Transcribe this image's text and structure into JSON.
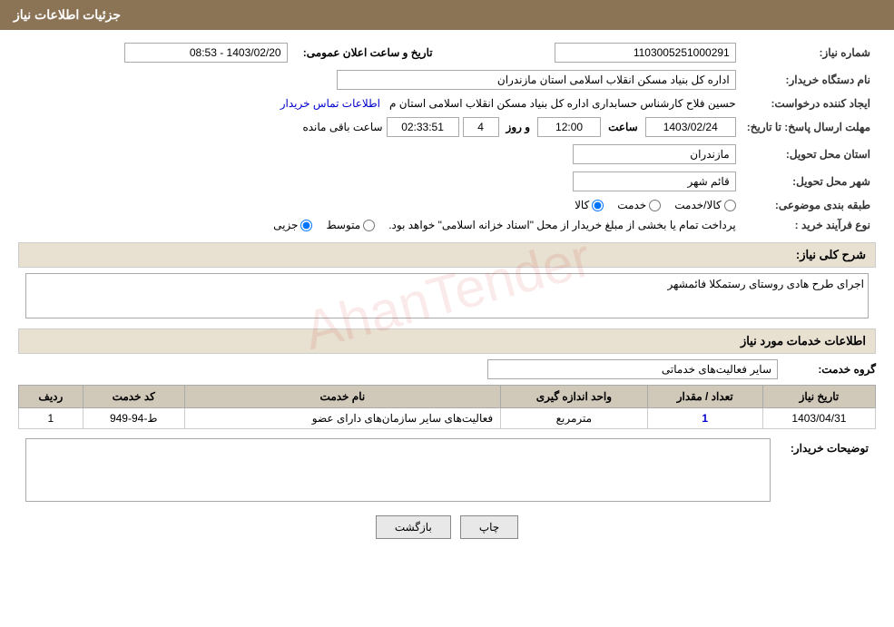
{
  "header": {
    "title": "جزئیات اطلاعات نیاز"
  },
  "labels": {
    "need_number": "شماره نیاز:",
    "buyer_org": "نام دستگاه خریدار:",
    "requester": "ایجاد کننده درخواست:",
    "response_deadline": "مهلت ارسال پاسخ: تا تاریخ:",
    "delivery_province": "استان محل تحویل:",
    "delivery_city": "شهر محل تحویل:",
    "category": "طبقه بندی موضوعی:",
    "purchase_type": "نوع فرآیند خرید :",
    "need_description": "شرح کلی نیاز:",
    "service_info": "اطلاعات خدمات مورد نیاز",
    "service_group": "گروه خدمت:",
    "buyer_notes": "توضیحات خریدار:"
  },
  "values": {
    "need_number": "1103005251000291",
    "announce_date_label": "تاریخ و ساعت اعلان عمومی:",
    "announce_date": "1403/02/20 - 08:53",
    "buyer_org": "اداره کل بنیاد مسکن انقلاب اسلامی استان مازندران",
    "requester_name": "حسین فلاح کارشناس حسابداری اداره کل بنیاد مسکن انقلاب اسلامی استان م",
    "requester_link": "اطلاعات تماس خریدار",
    "date_value": "1403/02/24",
    "time_value": "12:00",
    "days_value": "4",
    "remained_value": "02:33:51",
    "remained_label": "ساعت باقی مانده",
    "delivery_province": "مازندران",
    "delivery_city": "قائم شهر",
    "category_options": [
      "کالا",
      "خدمت",
      "کالا/خدمت"
    ],
    "category_selected": "کالا",
    "purchase_type_options": [
      "جزیی",
      "متوسط"
    ],
    "purchase_type_note": "پرداخت تمام یا بخشی از مبلغ خریدار از محل \"اسناد خزانه اسلامی\" خواهد بود.",
    "need_desc_text": "اجرای طرح هادی روستای رستمکلا فائمشهر",
    "service_group_value": "سایر فعالیت‌های خدماتی",
    "table_headers": {
      "row_num": "ردیف",
      "service_code": "کد خدمت",
      "service_name": "نام خدمت",
      "unit": "واحد اندازه گیری",
      "quantity": "تعداد / مقدار",
      "date": "تاریخ نیاز"
    },
    "table_rows": [
      {
        "row_num": "1",
        "service_code": "ط-94-949",
        "service_name": "فعالیت‌های سایر سازمان‌های دارای عضو",
        "unit": "مترمربع",
        "quantity": "1",
        "date": "1403/04/31"
      }
    ],
    "buyer_notes_text": ""
  },
  "buttons": {
    "print": "چاپ",
    "back": "بازگشت"
  }
}
